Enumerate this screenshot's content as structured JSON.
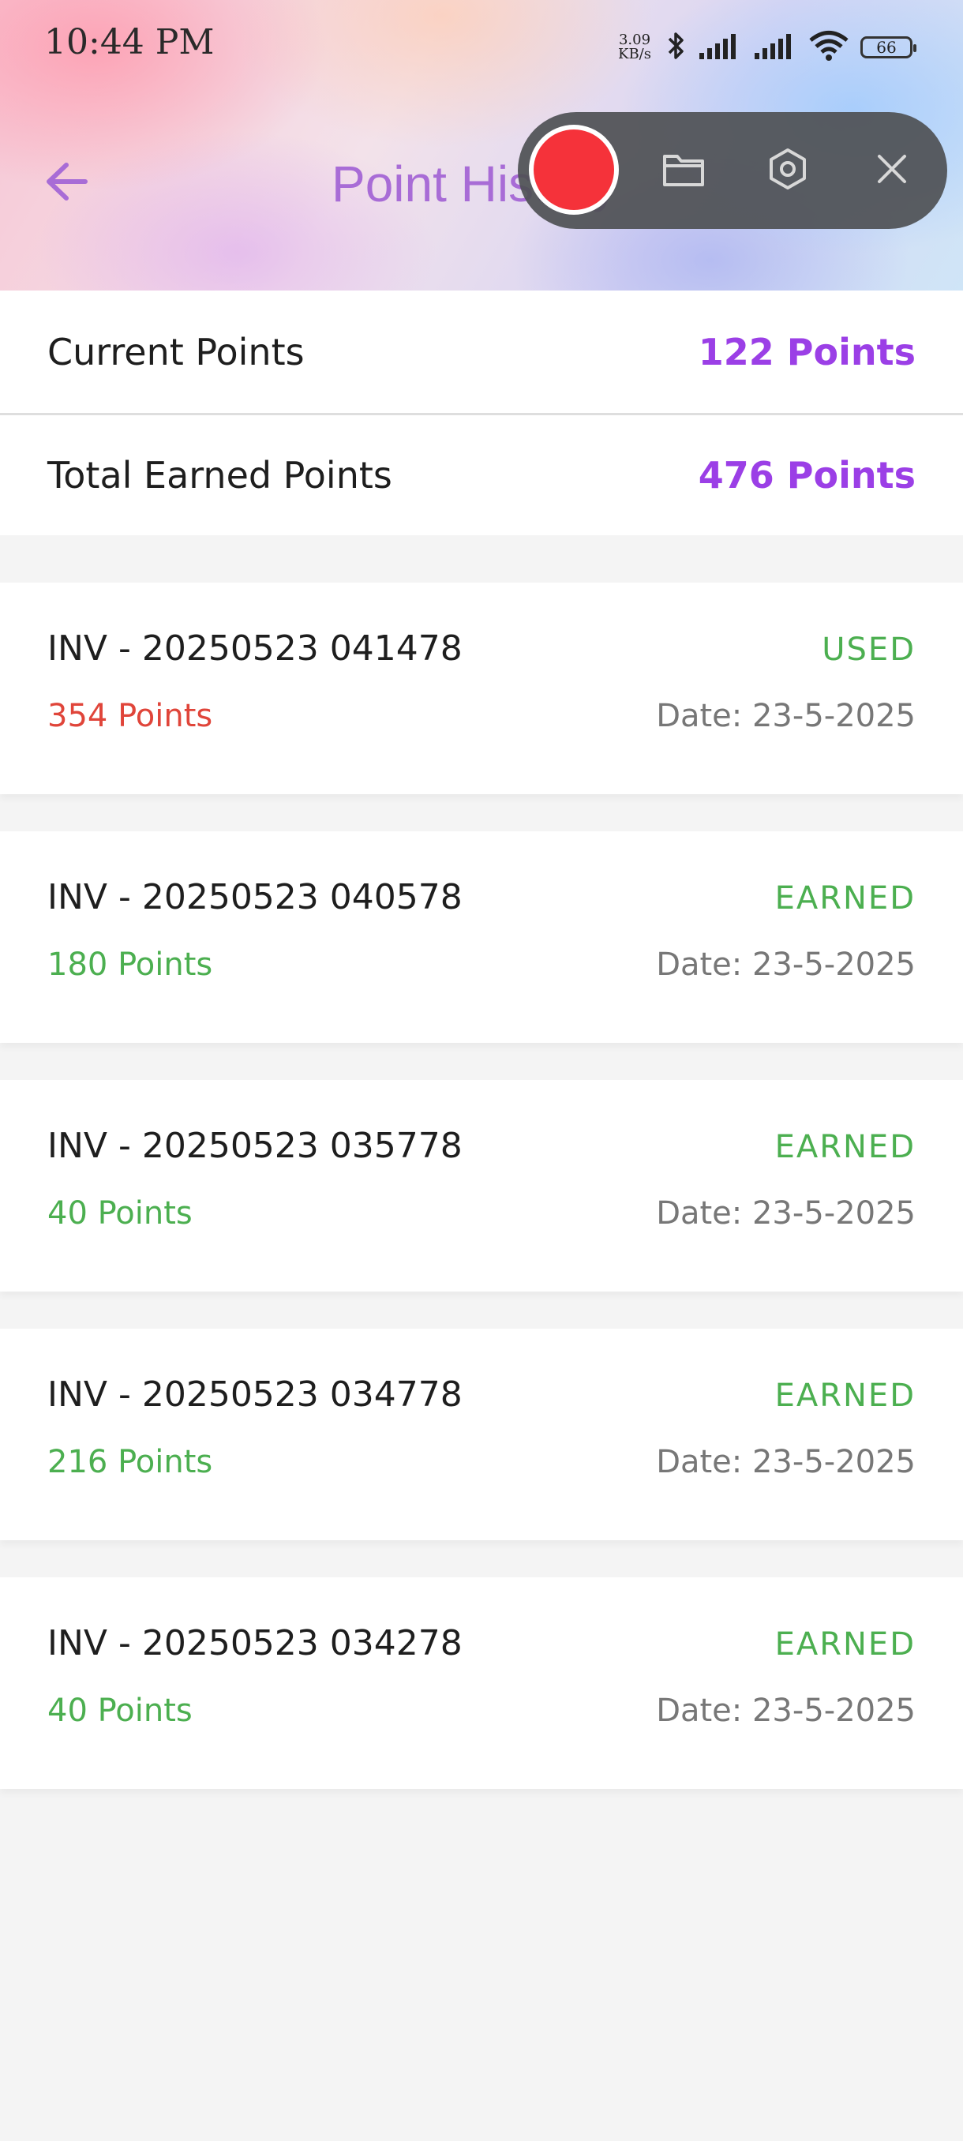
{
  "status_bar": {
    "time": "10:44 PM",
    "net_speed_top": "3.09",
    "net_speed_bottom": "KB/s",
    "battery": "66",
    "icons": [
      "bluetooth-icon",
      "signal-icon",
      "signal-icon",
      "wifi-icon",
      "battery-icon"
    ]
  },
  "header": {
    "title": "Point History",
    "back_icon": "arrow-left-icon"
  },
  "recorder": {
    "icons": [
      "record-icon",
      "folder-icon",
      "settings-icon",
      "close-icon"
    ]
  },
  "summary": {
    "current_label": "Current Points",
    "current_value": "122 Points",
    "total_label": "Total Earned Points",
    "total_value": "476 Points"
  },
  "transactions": [
    {
      "invoice": "INV - 20250523 041478",
      "points": "354 Points",
      "status": "USED",
      "date": "Date: 23-5-2025"
    },
    {
      "invoice": "INV - 20250523 040578",
      "points": "180 Points",
      "status": "EARNED",
      "date": "Date: 23-5-2025"
    },
    {
      "invoice": "INV - 20250523 035778",
      "points": "40 Points",
      "status": "EARNED",
      "date": "Date: 23-5-2025"
    },
    {
      "invoice": "INV - 20250523 034778",
      "points": "216 Points",
      "status": "EARNED",
      "date": "Date: 23-5-2025"
    },
    {
      "invoice": "INV - 20250523 034278",
      "points": "40 Points",
      "status": "EARNED",
      "date": "Date: 23-5-2025"
    }
  ],
  "colors": {
    "accent": "#9b3fe6",
    "title": "#a86cd6",
    "earned": "#4caf50",
    "used": "#e0453a",
    "record": "#f5323a"
  }
}
